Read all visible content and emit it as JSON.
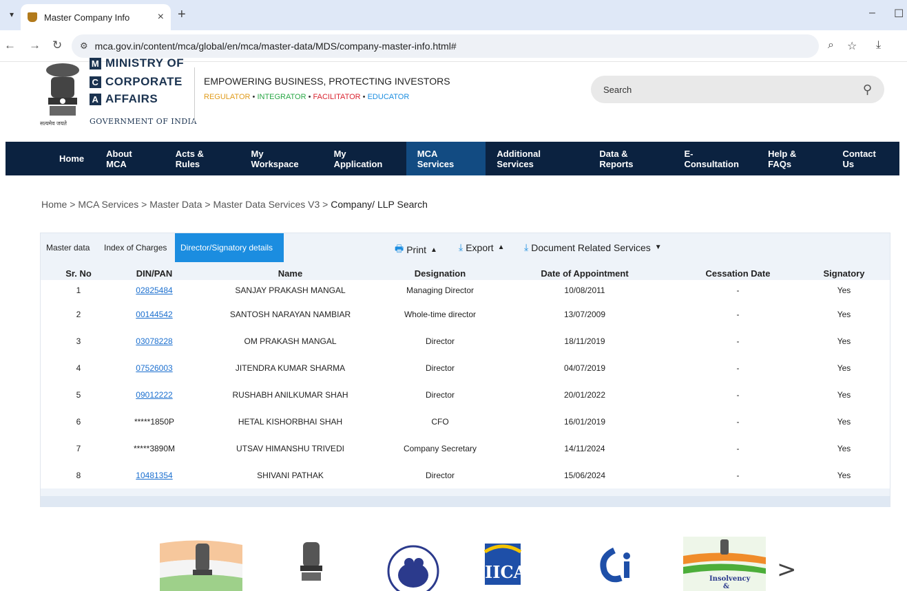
{
  "browser": {
    "tab_title": "Master Company Info",
    "url": "mca.gov.in/content/mca/global/en/mca/master-data/MDS/company-master-info.html#"
  },
  "header": {
    "logo_line1": "MINISTRY OF",
    "logo_line2_letter": "C",
    "logo_line2": "CORPORATE",
    "logo_line3_letter": "A",
    "logo_line3": "AFFAIRS",
    "government": "GOVERNMENT OF INDIA",
    "satyamev": "सत्यमेव जयते",
    "tagline": "EMPOWERING BUSINESS, PROTECTING INVESTORS",
    "roles": [
      "REGULATOR",
      "INTEGRATOR",
      "FACILITATOR",
      "EDUCATOR"
    ],
    "role_colors": [
      "#e09b1b",
      "#28a745",
      "#d9232f",
      "#1b8de0"
    ],
    "search_placeholder": "Search"
  },
  "nav": {
    "items": [
      "Home",
      "About MCA",
      "Acts & Rules",
      "My Workspace",
      "My Application",
      "MCA Services",
      "Additional Services",
      "Data & Reports",
      "E-Consultation",
      "Help & FAQs",
      "Contact Us"
    ],
    "active": "MCA Services"
  },
  "breadcrumb": {
    "items": [
      "Home",
      "MCA Services",
      "Master Data",
      "Master Data Services V3"
    ],
    "current": "Company/ LLP Search"
  },
  "panel": {
    "tabs": [
      "Master data",
      "Index of Charges",
      "Director/Signatory details"
    ],
    "active_tab": "Director/Signatory details",
    "print": "Print",
    "export": "Export",
    "document_services": "Document Related Services",
    "columns": [
      "Sr. No",
      "DIN/PAN",
      "Name",
      "Designation",
      "Date of Appointment",
      "Cessation Date",
      "Signatory"
    ],
    "rows": [
      {
        "sr": "1",
        "din": "02825484",
        "link": true,
        "name": "SANJAY PRAKASH MANGAL",
        "designation": "Managing Director",
        "appointed": "10/08/2011",
        "cessation": "-",
        "signatory": "Yes"
      },
      {
        "sr": "2",
        "din": "00144542",
        "link": true,
        "name": "SANTOSH NARAYAN NAMBIAR",
        "designation": "Whole-time director",
        "appointed": "13/07/2009",
        "cessation": "-",
        "signatory": "Yes"
      },
      {
        "sr": "3",
        "din": "03078228",
        "link": true,
        "name": "OM PRAKASH MANGAL",
        "designation": "Director",
        "appointed": "18/11/2019",
        "cessation": "-",
        "signatory": "Yes"
      },
      {
        "sr": "4",
        "din": "07526003",
        "link": true,
        "name": "JITENDRA KUMAR SHARMA",
        "designation": "Director",
        "appointed": "04/07/2019",
        "cessation": "-",
        "signatory": "Yes"
      },
      {
        "sr": "5",
        "din": "09012222",
        "link": true,
        "name": "RUSHABH ANILKUMAR SHAH",
        "designation": "Director",
        "appointed": "20/01/2022",
        "cessation": "-",
        "signatory": "Yes"
      },
      {
        "sr": "6",
        "din": "*****1850P",
        "link": false,
        "name": "HETAL KISHORBHAI SHAH",
        "designation": "CFO",
        "appointed": "16/01/2019",
        "cessation": "-",
        "signatory": "Yes"
      },
      {
        "sr": "7",
        "din": "*****3890M",
        "link": false,
        "name": "UTSAV HIMANSHU TRIVEDI",
        "designation": "Company Secretary",
        "appointed": "14/11/2024",
        "cessation": "-",
        "signatory": "Yes"
      },
      {
        "sr": "8",
        "din": "10481354",
        "link": true,
        "name": "SHIVANI PATHAK",
        "designation": "Director",
        "appointed": "15/06/2024",
        "cessation": "-",
        "signatory": "Yes"
      }
    ]
  },
  "footer": {
    "logos": [
      "india-flag-emblem-logo",
      "national-emblem-logo",
      "iepf-authority-logo",
      "iica-logo",
      "cci-logo",
      "ibbi-logo"
    ],
    "iica_text": "IICA",
    "ibbi_text_1": "Insolvency",
    "ibbi_text_2": "&",
    "next_arrow": ">"
  }
}
